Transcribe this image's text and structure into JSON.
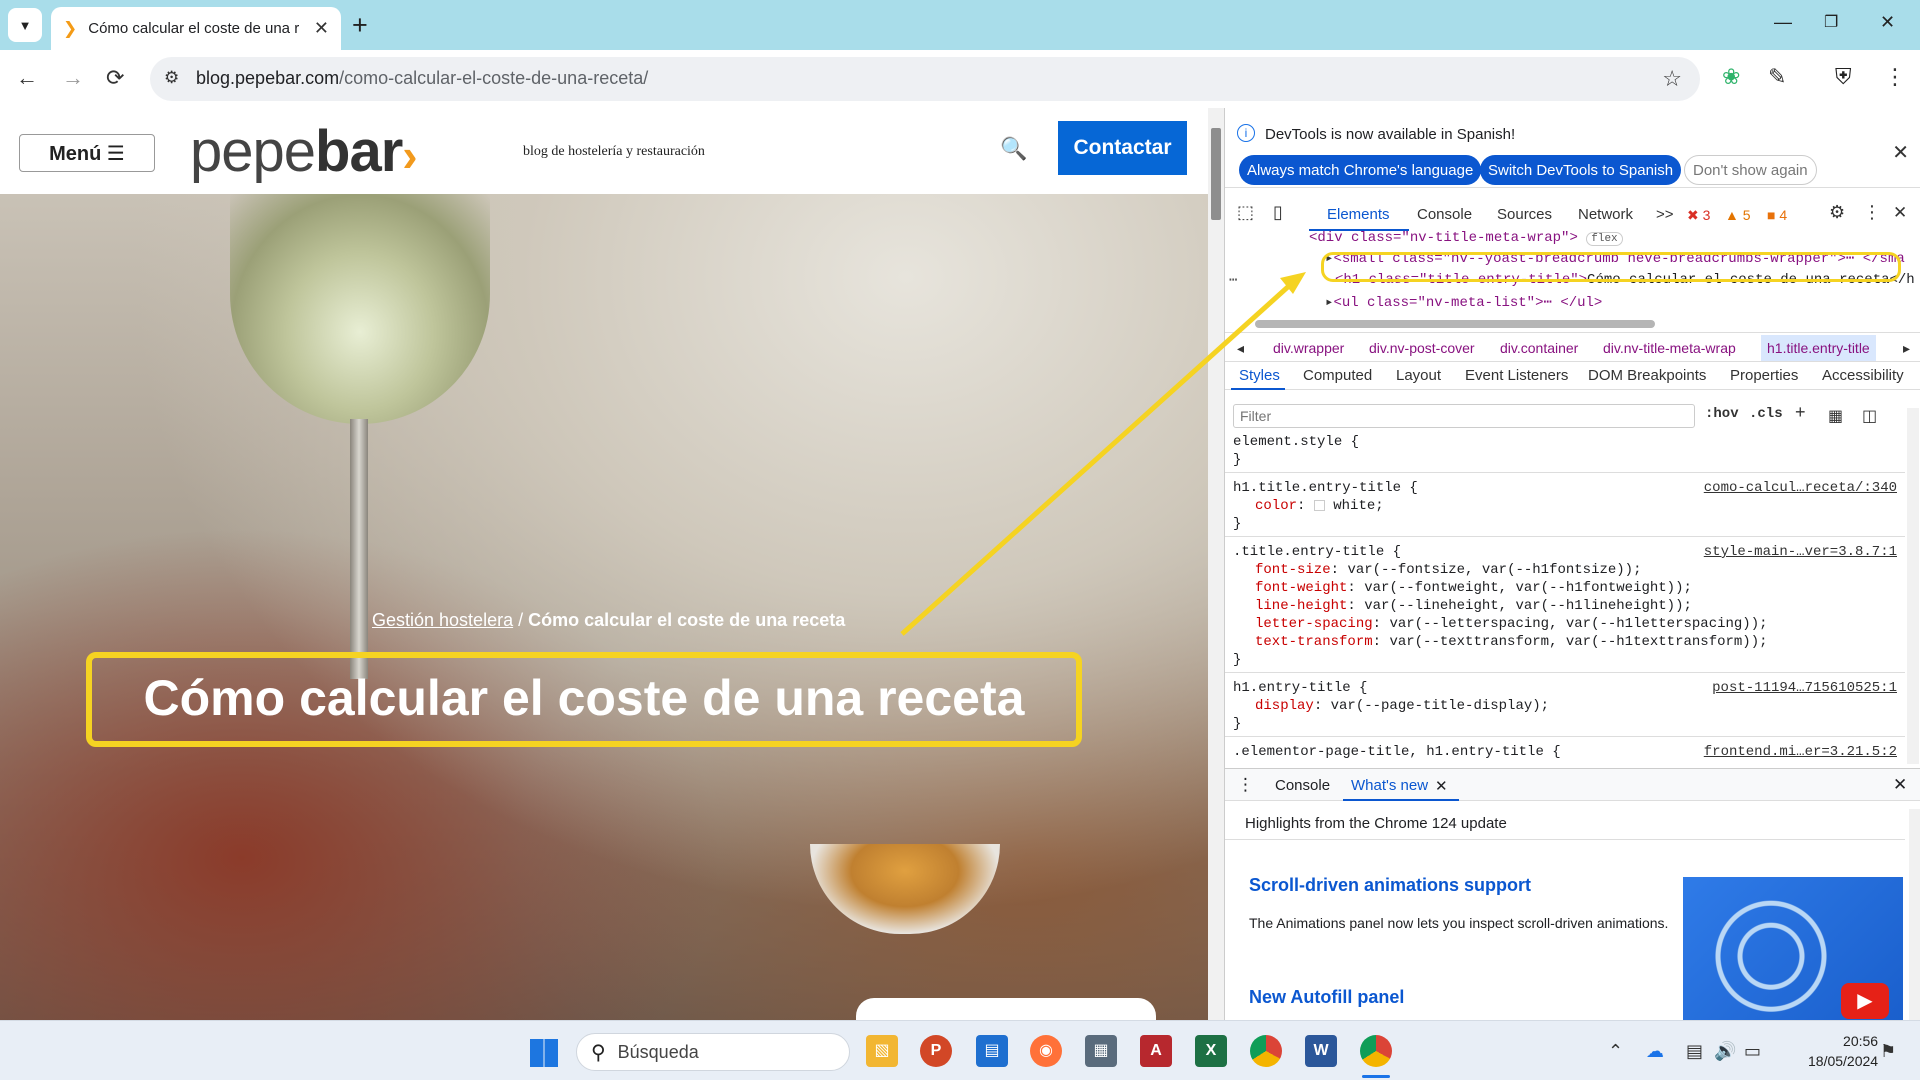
{
  "browser": {
    "tab_title": "Cómo calcular el coste de una r",
    "tab_close": "✕",
    "new_tab": "+",
    "url_domain": "blog.pepebar.com",
    "url_path": "/como-calcular-el-coste-de-una-receta/"
  },
  "site": {
    "menu_label": "Menú ☰",
    "logo_main": "pepe",
    "logo_bold": "bar",
    "logo_chevron": "›",
    "tagline": "blog de hostelería y restauración",
    "contact_label": "Contactar",
    "breadcrumb_link": "Gestión hostelera",
    "breadcrumb_sep": " / ",
    "breadcrumb_current": "Cómo calcular el coste de una receta",
    "title": "Cómo calcular el coste de una receta"
  },
  "devtools": {
    "info_text": "DevTools is now available in Spanish!",
    "btn_match": "Always match Chrome's language",
    "btn_switch": "Switch DevTools to Spanish",
    "btn_dont": "Don't show again",
    "tabs": [
      "Elements",
      "Console",
      "Sources",
      "Network",
      ">>"
    ],
    "errors": "3",
    "warnings": "5",
    "issues": "4",
    "dom": {
      "line1": "<div class=\"nv-title-meta-wrap\">",
      "line1_badge": "flex",
      "line2": "<small class=\"nv--yoast-breadcrumb neve-breadcrumbs-wrapper\">",
      "line2_end": "⋯ </sma",
      "line3_tag": "<h1 class=\"title entry-title\">",
      "line3_text": "Cómo calcular el coste de una receta</h",
      "line4": "<ul class=\"nv-meta-list\">",
      "line4_end": "⋯ </ul>",
      "ellipsis": "⋯"
    },
    "breadcrumbs": [
      "div.wrapper",
      "div.nv-post-cover",
      "div.container",
      "div.nv-title-meta-wrap",
      "h1.title.entry-title"
    ],
    "style_tabs": [
      "Styles",
      "Computed",
      "Layout",
      "Event Listeners",
      "DOM Breakpoints",
      "Properties",
      "Accessibility"
    ],
    "filter_placeholder": "Filter",
    "hov": ":hov",
    "cls": ".cls",
    "css": {
      "r0_sel": "element.style {",
      "close": "}",
      "r1_sel": "h1.title.entry-title {",
      "r1_src": "como-calcul…receta/:340",
      "r1_p1_name": "color",
      "r1_p1_val": "white;",
      "r2_sel": ".title.entry-title {",
      "r2_src": "style-main-…ver=3.8.7:1",
      "r2_p1_name": "font-size",
      "r2_p1_val": "var(--fontsize, var(--h1fontsize));",
      "r2_p2_name": "font-weight",
      "r2_p2_val": "var(--fontweight, var(--h1fontweight));",
      "r2_p3_name": "line-height",
      "r2_p3_val": "var(--lineheight, var(--h1lineheight));",
      "r2_p4_name": "letter-spacing",
      "r2_p4_val": "var(--letterspacing, var(--h1letterspacing));",
      "r2_p5_name": "text-transform",
      "r2_p5_val": "var(--texttransform, var(--h1texttransform));",
      "r3_sel": "h1.entry-title {",
      "r3_src": "post-11194…715610525:1",
      "r3_p1_name": "display",
      "r3_p1_val": "var(--page-title-display);",
      "r4_sel": ".elementor-page-title, h1.entry-title {",
      "r4_src": "frontend.mi…er=3.21.5:2"
    },
    "drawer": {
      "tab_console": "Console",
      "tab_whatsnew": "What's new",
      "highlights": "Highlights from the Chrome 124 update",
      "h_scroll": "Scroll-driven animations support",
      "p_scroll": "The Animations panel now lets you inspect scroll-driven animations.",
      "h_autofill": "New Autofill panel"
    }
  },
  "taskbar": {
    "search_placeholder": "Búsqueda",
    "time": "20:56",
    "date": "18/05/2024"
  },
  "colors": {
    "accent_yellow": "#f5d322",
    "contact_blue": "#0667d6",
    "devtools_blue": "#0b57d0"
  }
}
